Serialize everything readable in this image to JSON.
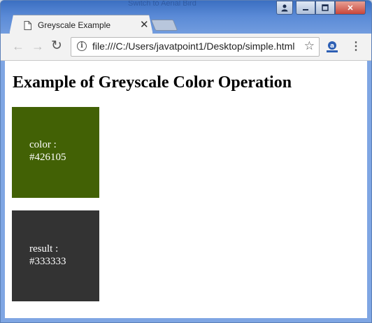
{
  "window": {
    "background_tab_text": "Switch to Aerial Bird"
  },
  "tab": {
    "title": "Greyscale Example",
    "close_glyph": "✕",
    "favicon": "page-icon"
  },
  "toolbar": {
    "back_glyph": "←",
    "forward_glyph": "→",
    "reload_glyph": "↻",
    "url": "file:///C:/Users/javatpoint1/Desktop/simple.html",
    "star_glyph": "☆",
    "menu_glyph": "⋮"
  },
  "window_controls": {
    "user_glyph": "👤",
    "minimize_glyph": "▁",
    "maximize_glyph": "▢",
    "close_glyph": "✕"
  },
  "page": {
    "heading": "Example of Greyscale Color Operation",
    "color_label": "color :",
    "color_value": "#426105",
    "result_label": "result :",
    "result_value": "#333333"
  },
  "colors": {
    "original": "#426105",
    "greyscale": "#333333"
  }
}
